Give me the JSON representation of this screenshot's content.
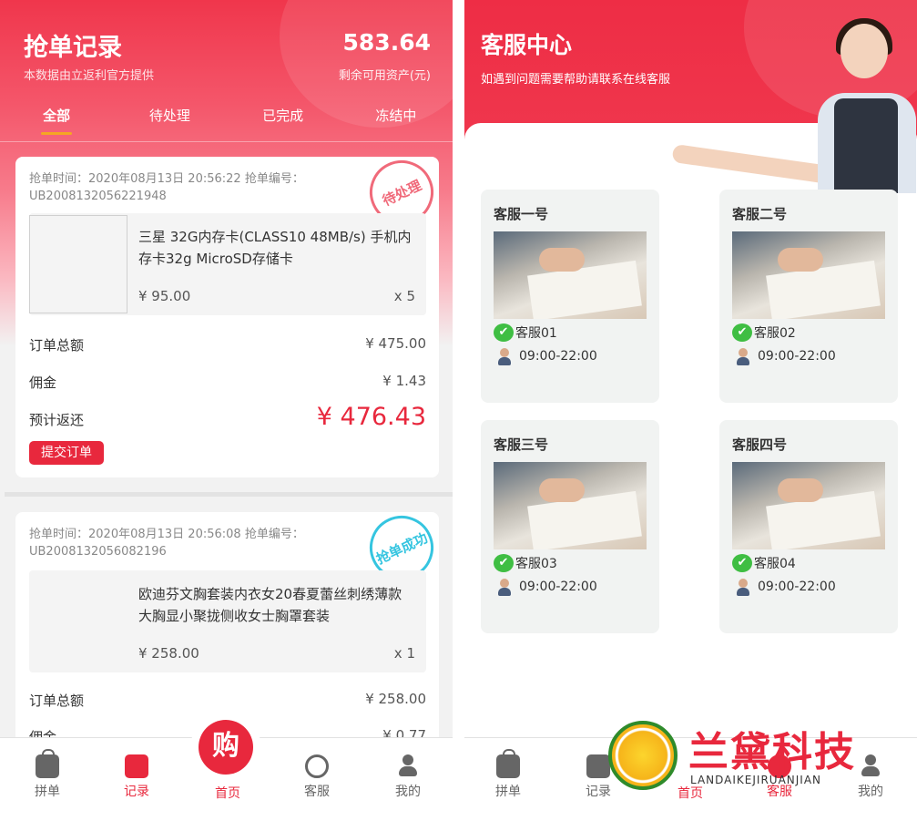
{
  "left_screen": {
    "title": "抢单记录",
    "subtitle": "本数据由立返利官方提供",
    "balance": "583.64",
    "balance_label": "剩余可用资产(元)",
    "tabs": [
      "全部",
      "待处理",
      "已完成",
      "冻结中"
    ],
    "active_tab": "全部",
    "orders": [
      {
        "meta": "抢单时间：2020年08月13日 20:56:22 抢单编号：UB2008132056221948",
        "stamp": "待处理",
        "product_name": "三星 32G内存卡(CLASS10 48MB/s) 手机内存卡32g MicroSD存储卡",
        "price": "¥ 95.00",
        "qty": "x 5",
        "total_label": "订单总额",
        "total": "¥ 475.00",
        "commission_label": "佣金",
        "commission": "¥ 1.43",
        "return_label": "预计返还",
        "return": "¥ 476.43",
        "submit_label": "提交订单"
      },
      {
        "meta": "抢单时间：2020年08月13日 20:56:08 抢单编号：UB2008132056082196",
        "stamp": "抢单成功",
        "product_name": "欧迪芬文胸套装内衣女20春夏蕾丝刺绣薄款大胸显小聚拢侧收女士胸罩套装",
        "price": "¥ 258.00",
        "qty": "x 1",
        "total_label": "订单总额",
        "total": "¥ 258.00",
        "commission_label": "佣金",
        "commission": "¥ 0.77"
      }
    ]
  },
  "tabbar": {
    "items": [
      {
        "label": "拼单",
        "icon": "bag-icon"
      },
      {
        "label": "记录",
        "icon": "record-icon"
      },
      {
        "label": "首页",
        "icon": "buy-icon"
      },
      {
        "label": "客服",
        "icon": "headset-icon"
      },
      {
        "label": "我的",
        "icon": "user-icon"
      }
    ],
    "center_glyph": "购",
    "accent": "#e8283d"
  },
  "right_screen": {
    "title": "客服中心",
    "subtitle": "如遇到问题需要帮助请联系在线客服",
    "agents": [
      {
        "title": "客服一号",
        "name": "客服01",
        "hours": "09:00-22:00"
      },
      {
        "title": "客服二号",
        "name": "客服02",
        "hours": "09:00-22:00"
      },
      {
        "title": "客服三号",
        "name": "客服03",
        "hours": "09:00-22:00"
      },
      {
        "title": "客服四号",
        "name": "客服04",
        "hours": "09:00-22:00"
      }
    ]
  },
  "watermark": {
    "text": "兰黛科技",
    "en": "LANDAIKEJIRUANJIAN"
  }
}
